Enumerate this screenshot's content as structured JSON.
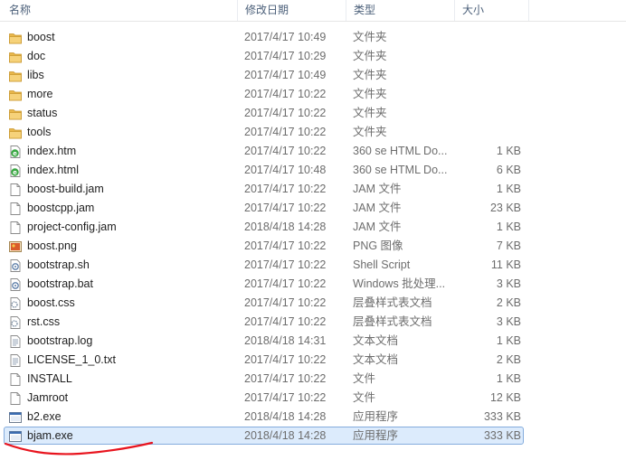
{
  "columns": {
    "name": "名称",
    "date": "修改日期",
    "type": "类型",
    "size": "大小"
  },
  "files": [
    {
      "name": "boost",
      "date": "2017/4/17 10:49",
      "type": "文件夹",
      "size": "",
      "icon": "folder"
    },
    {
      "name": "doc",
      "date": "2017/4/17 10:29",
      "type": "文件夹",
      "size": "",
      "icon": "folder"
    },
    {
      "name": "libs",
      "date": "2017/4/17 10:49",
      "type": "文件夹",
      "size": "",
      "icon": "folder"
    },
    {
      "name": "more",
      "date": "2017/4/17 10:22",
      "type": "文件夹",
      "size": "",
      "icon": "folder"
    },
    {
      "name": "status",
      "date": "2017/4/17 10:22",
      "type": "文件夹",
      "size": "",
      "icon": "folder"
    },
    {
      "name": "tools",
      "date": "2017/4/17 10:22",
      "type": "文件夹",
      "size": "",
      "icon": "folder"
    },
    {
      "name": "index.htm",
      "date": "2017/4/17 10:22",
      "type": "360 se HTML Do...",
      "size": "1 KB",
      "icon": "html"
    },
    {
      "name": "index.html",
      "date": "2017/4/17 10:48",
      "type": "360 se HTML Do...",
      "size": "6 KB",
      "icon": "html"
    },
    {
      "name": "boost-build.jam",
      "date": "2017/4/17 10:22",
      "type": "JAM 文件",
      "size": "1 KB",
      "icon": "blank"
    },
    {
      "name": "boostcpp.jam",
      "date": "2017/4/17 10:22",
      "type": "JAM 文件",
      "size": "23 KB",
      "icon": "blank"
    },
    {
      "name": "project-config.jam",
      "date": "2018/4/18 14:28",
      "type": "JAM 文件",
      "size": "1 KB",
      "icon": "blank"
    },
    {
      "name": "boost.png",
      "date": "2017/4/17 10:22",
      "type": "PNG 图像",
      "size": "7 KB",
      "icon": "image"
    },
    {
      "name": "bootstrap.sh",
      "date": "2017/4/17 10:22",
      "type": "Shell Script",
      "size": "11 KB",
      "icon": "script"
    },
    {
      "name": "bootstrap.bat",
      "date": "2017/4/17 10:22",
      "type": "Windows 批处理...",
      "size": "3 KB",
      "icon": "script"
    },
    {
      "name": "boost.css",
      "date": "2017/4/17 10:22",
      "type": "层叠样式表文档",
      "size": "2 KB",
      "icon": "css"
    },
    {
      "name": "rst.css",
      "date": "2017/4/17 10:22",
      "type": "层叠样式表文档",
      "size": "3 KB",
      "icon": "css"
    },
    {
      "name": "bootstrap.log",
      "date": "2018/4/18 14:31",
      "type": "文本文档",
      "size": "1 KB",
      "icon": "text"
    },
    {
      "name": "LICENSE_1_0.txt",
      "date": "2017/4/17 10:22",
      "type": "文本文档",
      "size": "2 KB",
      "icon": "text"
    },
    {
      "name": "INSTALL",
      "date": "2017/4/17 10:22",
      "type": "文件",
      "size": "1 KB",
      "icon": "blank"
    },
    {
      "name": "Jamroot",
      "date": "2017/4/17 10:22",
      "type": "文件",
      "size": "12 KB",
      "icon": "blank"
    },
    {
      "name": "b2.exe",
      "date": "2018/4/18 14:28",
      "type": "应用程序",
      "size": "333 KB",
      "icon": "exe"
    },
    {
      "name": "bjam.exe",
      "date": "2018/4/18 14:28",
      "type": "应用程序",
      "size": "333 KB",
      "icon": "exe",
      "selected": true
    }
  ],
  "annotation_color": "#e8141e"
}
